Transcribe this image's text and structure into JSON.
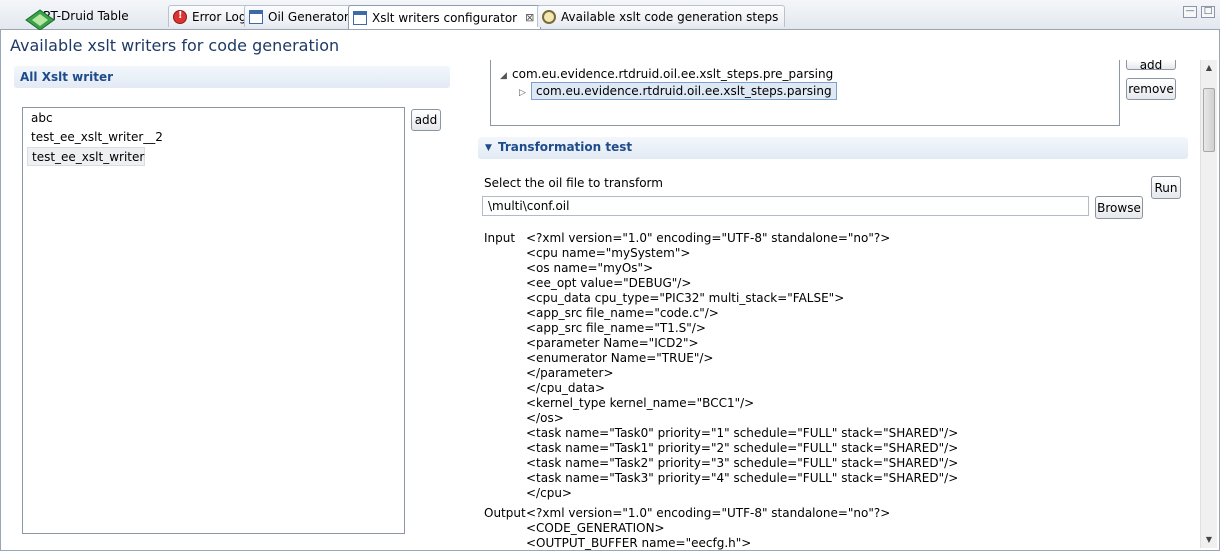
{
  "tabs": [
    {
      "label": "RT-Druid Table",
      "icon": "rtdruid-diamond-icon"
    },
    {
      "label": "Error Log",
      "icon": "error-log-icon"
    },
    {
      "label": "Oil Generators",
      "icon": "window-icon"
    },
    {
      "label": "Xslt writers configurator",
      "icon": "window-icon",
      "close": "⊠"
    },
    {
      "label": "Available xslt code generation steps",
      "icon": "gear-icon"
    }
  ],
  "window_controls": {
    "minimize": "—",
    "maximize": "□"
  },
  "page_title": "Available xslt writers for code generation",
  "left": {
    "section_title": "All Xslt writer",
    "items": [
      "abc",
      "test_ee_xslt_writer__2",
      "test_ee_xslt_writer"
    ],
    "add_label": "add"
  },
  "steps": {
    "items": [
      "com.eu.evidence.rtdruid.oil.ee.xslt_steps.pre_parsing",
      "com.eu.evidence.rtdruid.oil.ee.xslt_steps.parsing"
    ],
    "add_label": "add",
    "remove_label": "remove"
  },
  "transformation": {
    "title": "Transformation test",
    "select_label": "Select the oil file to transform",
    "file_value": "\\multi\\conf.oil",
    "browse_label": "Browse",
    "run_label": "Run",
    "input_label": "Input",
    "input_lines": [
      "<?xml version=\"1.0\" encoding=\"UTF-8\" standalone=\"no\"?>",
      "<cpu name=\"mySystem\">",
      "<os name=\"myOs\">",
      "<ee_opt value=\"DEBUG\"/>",
      "<cpu_data cpu_type=\"PIC32\" multi_stack=\"FALSE\">",
      "<app_src file_name=\"code.c\"/>",
      "<app_src file_name=\"T1.S\"/>",
      "<parameter Name=\"ICD2\">",
      "<enumerator Name=\"TRUE\"/>",
      "</parameter>",
      "</cpu_data>",
      "<kernel_type kernel_name=\"BCC1\"/>",
      "</os>",
      "<task name=\"Task0\" priority=\"1\" schedule=\"FULL\" stack=\"SHARED\"/>",
      "<task name=\"Task1\" priority=\"2\" schedule=\"FULL\" stack=\"SHARED\"/>",
      "<task name=\"Task2\" priority=\"3\" schedule=\"FULL\" stack=\"SHARED\"/>",
      "<task name=\"Task3\" priority=\"4\" schedule=\"FULL\" stack=\"SHARED\"/>",
      "</cpu>"
    ],
    "output_label": "Output",
    "output_lines": [
      "<?xml version=\"1.0\" encoding=\"UTF-8\" standalone=\"no\"?>",
      "<CODE_GENERATION>",
      "<OUTPUT_BUFFER name=\"eecfg.h\">"
    ]
  }
}
